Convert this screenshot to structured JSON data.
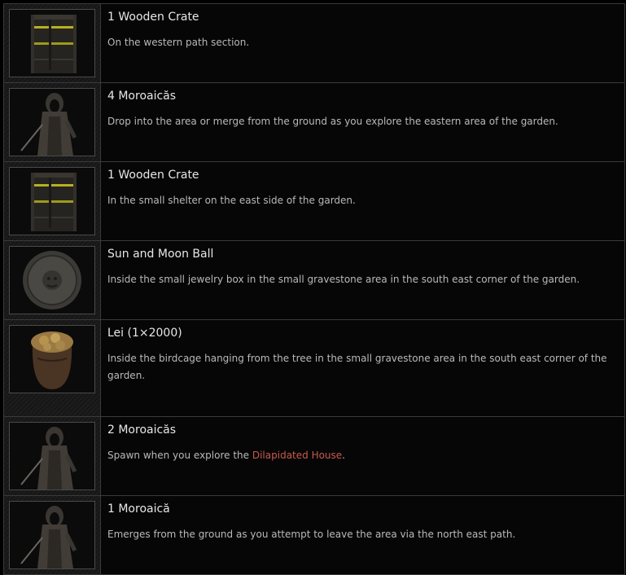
{
  "rows": [
    {
      "icon": "wooden-crate-icon",
      "title": "1 Wooden Crate",
      "description": "On the western path section."
    },
    {
      "icon": "moroaica-icon",
      "title": "4 Moroaicăs",
      "description": "Drop into the area or merge from the ground as you explore the eastern area of the garden."
    },
    {
      "icon": "wooden-crate-icon",
      "title": "1 Wooden Crate",
      "description": "In the small shelter on the east side of the garden."
    },
    {
      "icon": "sun-and-moon-ball-icon",
      "title": "Sun and Moon Ball",
      "description": "Inside the small jewelry box in the small gravestone area in the south east corner of the garden."
    },
    {
      "icon": "lei-coin-pouch-icon",
      "title": "Lei (1×2000)",
      "description": "Inside the birdcage hanging from the tree in the small gravestone area in the south east corner of the garden."
    },
    {
      "icon": "moroaica-icon",
      "title": "2 Moroaicăs",
      "description_before": "Spawn when you explore the ",
      "link": "Dilapidated House",
      "description_after": "."
    },
    {
      "icon": "moroaica-icon",
      "title": "1 Moroaică",
      "description": "Emerges from the ground as you attempt to leave the area via the north east path."
    }
  ],
  "colors": {
    "link": "#c9594c",
    "background": "#000000",
    "border": "#3a3a3a"
  }
}
